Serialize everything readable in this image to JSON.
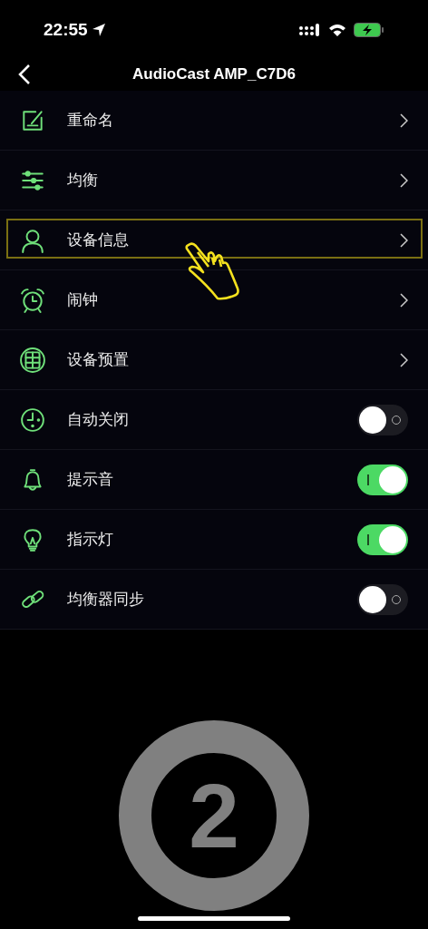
{
  "status_bar": {
    "time": "22:55"
  },
  "nav": {
    "title": "AudioCast AMP_C7D6"
  },
  "items": [
    {
      "kind": "link",
      "label": "重命名",
      "highlighted": false
    },
    {
      "kind": "link",
      "label": "均衡",
      "highlighted": false
    },
    {
      "kind": "link",
      "label": "设备信息",
      "highlighted": true
    },
    {
      "kind": "link",
      "label": "闹钟",
      "highlighted": false
    },
    {
      "kind": "link",
      "label": "设备预置",
      "highlighted": false
    },
    {
      "kind": "toggle",
      "label": "自动关闭",
      "on": false
    },
    {
      "kind": "toggle",
      "label": "提示音",
      "on": true
    },
    {
      "kind": "toggle",
      "label": "指示灯",
      "on": true
    },
    {
      "kind": "toggle",
      "label": "均衡器同步",
      "on": false
    }
  ],
  "step_badge": {
    "number": "2"
  }
}
